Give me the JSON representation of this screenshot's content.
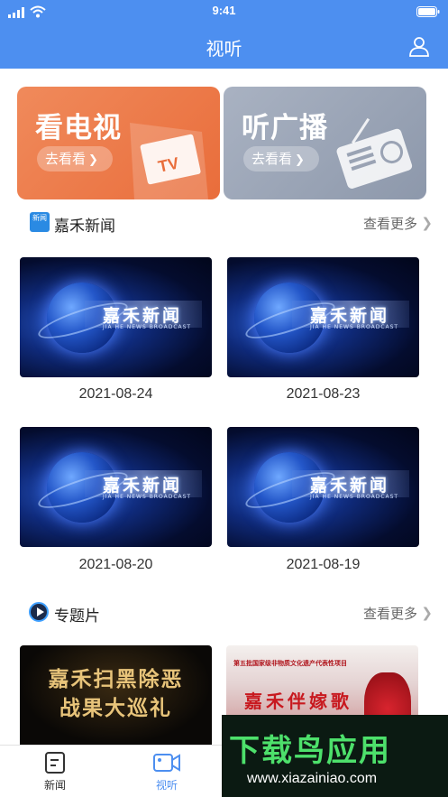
{
  "status": {
    "time": "9:41"
  },
  "header": {
    "title": "视听",
    "user_icon": "user-icon"
  },
  "banners": [
    {
      "title": "看电视",
      "button": "去看看",
      "deco_text": "TV",
      "color": "#ec7a48"
    },
    {
      "title": "听广播",
      "button": "去看看",
      "color": "#9aa3b4"
    }
  ],
  "news_section": {
    "icon_text": "新闻",
    "title": "嘉禾新闻",
    "more": "查看更多",
    "items": [
      {
        "thumb_title": "嘉禾新闻",
        "thumb_sub": "JIA HE NEWS BROADCAST",
        "date": "2021-08-24"
      },
      {
        "thumb_title": "嘉禾新闻",
        "thumb_sub": "JIA HE NEWS BROADCAST",
        "date": "2021-08-23"
      },
      {
        "thumb_title": "嘉禾新闻",
        "thumb_sub": "JIA HE NEWS BROADCAST",
        "date": "2021-08-20"
      },
      {
        "thumb_title": "嘉禾新闻",
        "thumb_sub": "JIA HE NEWS BROADCAST",
        "date": "2021-08-19"
      }
    ]
  },
  "special_section": {
    "title": "专题片",
    "more": "查看更多",
    "items": [
      {
        "line1": "嘉禾扫黑除恶",
        "line2": "战果大巡礼"
      },
      {
        "caption": "第五批国家级非物质文化遗产代表性项目",
        "title": "嘉禾伴嫁歌"
      }
    ]
  },
  "tabbar": {
    "items": [
      {
        "label": "新闻",
        "icon": "news-icon",
        "active": false
      },
      {
        "label": "视听",
        "icon": "video-icon",
        "active": true
      }
    ],
    "active_color": "#4d8ff0"
  },
  "watermark": {
    "brand": "下载鸟应用",
    "url": "www.xiazainiao.com"
  }
}
